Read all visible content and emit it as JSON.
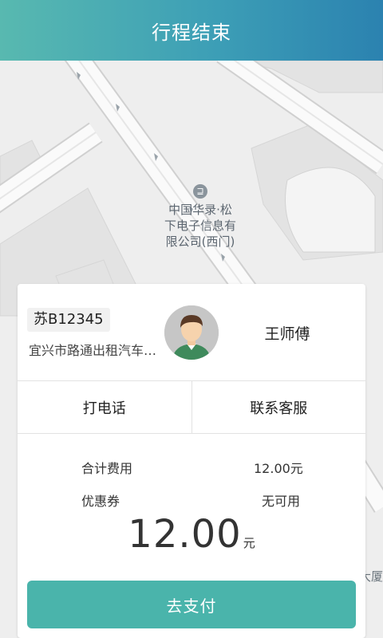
{
  "header": {
    "title": "行程结束"
  },
  "map": {
    "poi_icon": "⊒",
    "poi_lines": [
      "中国华录·松",
      "下电子信息有",
      "限公司(西门)"
    ],
    "edge_label": "大厦"
  },
  "driver": {
    "plate": "苏B12345",
    "company": "宜兴市路通出租汽车有限公司",
    "name": "王师傅",
    "avatar_icon": "driver-avatar"
  },
  "actions": {
    "call": "打电话",
    "service": "联系客服"
  },
  "fees": {
    "total_label": "合计费用",
    "total_value": "12.00元",
    "coupon_label": "优惠券",
    "coupon_value": "无可用"
  },
  "payment": {
    "amount": "12.00",
    "unit": "元",
    "button": "去支付"
  },
  "colors": {
    "header_start": "#58b9b0",
    "header_end": "#2b82b0",
    "accent": "#4ab4ab"
  }
}
